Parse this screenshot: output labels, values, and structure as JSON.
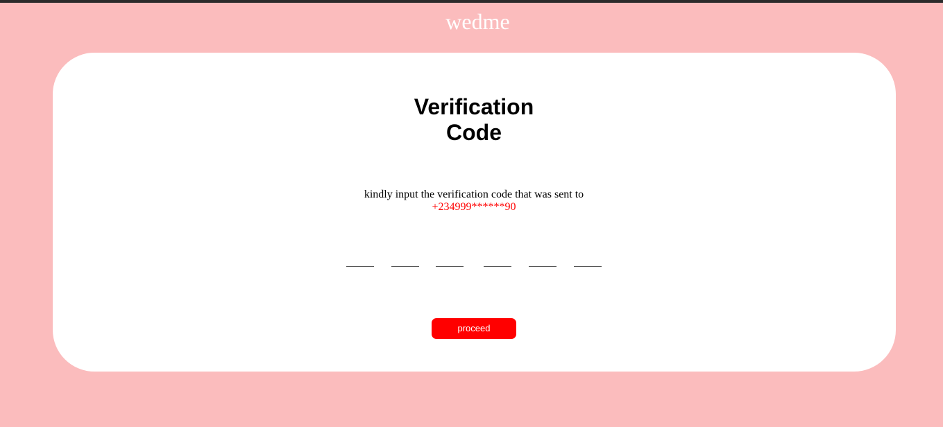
{
  "brand": {
    "name": "wedme"
  },
  "verification": {
    "title_line1": "Verification",
    "title_line2": "Code",
    "instruction": "kindly input the verification code that was sent to",
    "phone": "+234999******90",
    "code_boxes": [
      "",
      "",
      "",
      "",
      "",
      ""
    ],
    "proceed_label": "proceed"
  },
  "colors": {
    "page_background": "#fbbcbd",
    "card_background": "#ffffff",
    "accent": "#ff0000",
    "top_strip": "#2b2b2b"
  }
}
